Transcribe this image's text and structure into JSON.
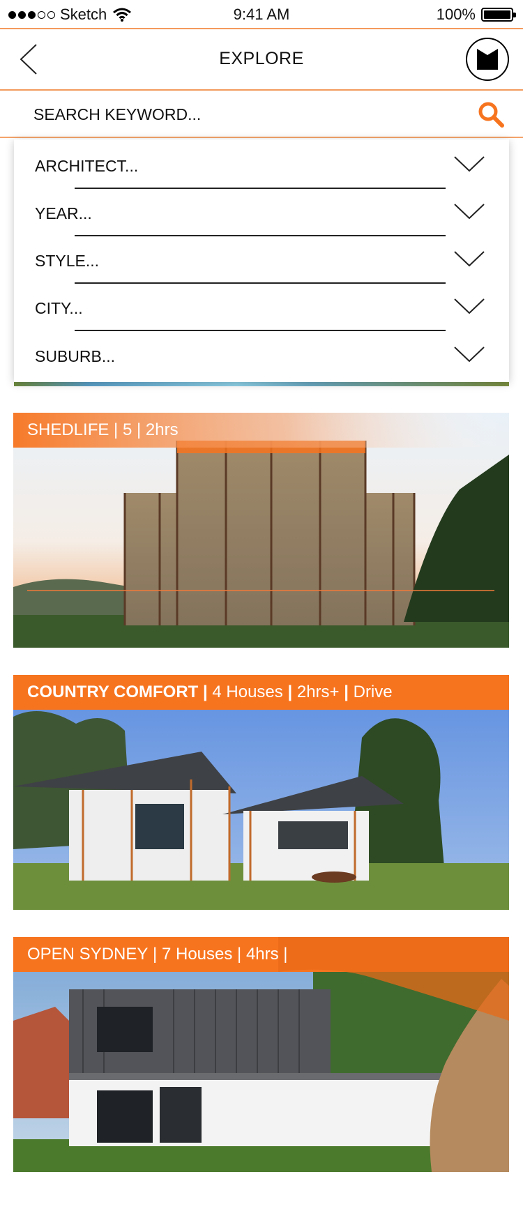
{
  "status_bar": {
    "carrier": "Sketch",
    "time": "9:41 AM",
    "battery": "100%"
  },
  "nav": {
    "title": "EXPLORE"
  },
  "search": {
    "placeholder": "SEARCH KEYWORD..."
  },
  "filters": [
    {
      "label": "ARCHITECT..."
    },
    {
      "label": "YEAR..."
    },
    {
      "label": "STYLE..."
    },
    {
      "label": "CITY..."
    },
    {
      "label": "SUBURB..."
    }
  ],
  "cards": [
    {
      "title": "SHEDLIFE",
      "sep1": " | ",
      "count": "5",
      "sep2": " | ",
      "duration": "2hrs"
    },
    {
      "title": "COUNTRY COMFORT",
      "sep1": " | ",
      "count": "4 Houses",
      "sep2": " | ",
      "duration": "2hrs+",
      "sep3": " | ",
      "mode": "Drive"
    },
    {
      "title": "OPEN SYDNEY",
      "sep1": " | ",
      "count": "7 Houses",
      "sep2": " | ",
      "duration": "4hrs",
      "sep3": " |"
    }
  ],
  "colors": {
    "accent": "#f7741f",
    "rule": "#f39a5c"
  },
  "icons": {
    "back": "chevron-left-icon",
    "profile": "brand-logo-icon",
    "search": "search-icon",
    "filter": "chevron-down-icon"
  }
}
